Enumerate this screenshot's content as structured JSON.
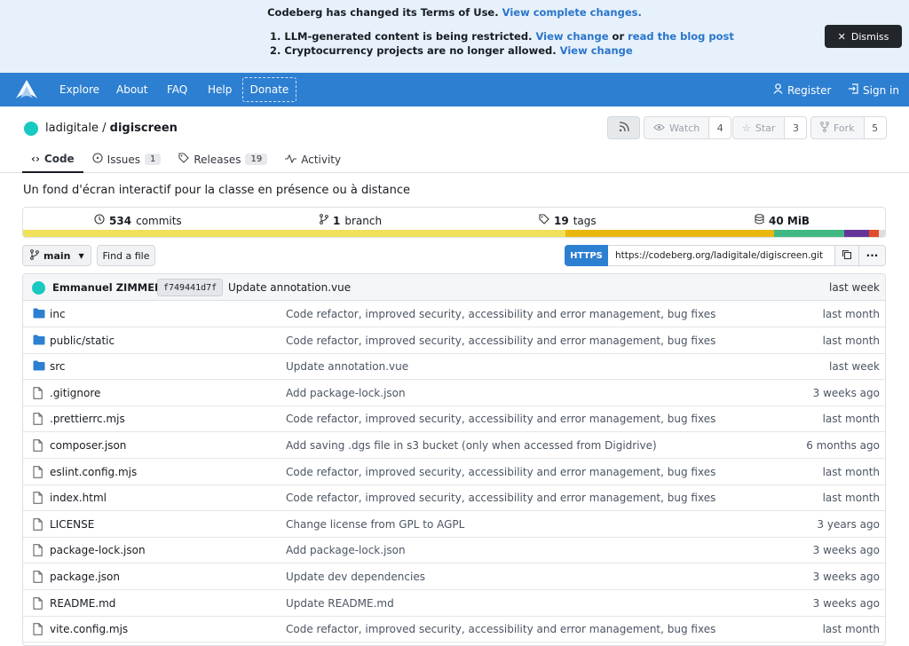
{
  "banner": {
    "headline_pre": "Codeberg has changed its Terms of Use.",
    "headline_link": "View complete changes.",
    "item1_text": "1. LLM-generated content is being restricted.",
    "item1_link1": "View change",
    "item1_or": "or",
    "item1_link2": "read the blog post",
    "item2_text": "2. Cryptocurrency projects are no longer allowed.",
    "item2_link": "View change",
    "dismiss_label": "Dismiss"
  },
  "nav": {
    "explore": "Explore",
    "about": "About",
    "faq": "FAQ",
    "help": "Help",
    "donate": "Donate",
    "register": "Register",
    "signin": "Sign in"
  },
  "repo": {
    "owner": "ladigitale",
    "separator": "/",
    "name": "digiscreen",
    "watch_label": "Watch",
    "watch_count": "4",
    "star_label": "Star",
    "star_count": "3",
    "fork_label": "Fork",
    "fork_count": "5",
    "description": "Un fond d'écran interactif pour la classe en présence ou à distance"
  },
  "tabs": [
    {
      "label": "Code",
      "active": true
    },
    {
      "label": "Issues",
      "count": "1"
    },
    {
      "label": "Releases",
      "count": "19"
    },
    {
      "label": "Activity"
    }
  ],
  "stats": {
    "commits_count": "534",
    "commits_label": "commits",
    "branch_count": "1",
    "branch_label": "branch",
    "tags_count": "19",
    "tags_label": "tags",
    "size": "40 MiB"
  },
  "language_bar": [
    {
      "color": "#f1e05a",
      "share": 0.628
    },
    {
      "color": "#e8b80f",
      "share": 0.241
    },
    {
      "color": "#41b883",
      "share": 0.082
    },
    {
      "color": "#663399",
      "share": 0.028
    },
    {
      "color": "#e34c26",
      "share": 0.012
    },
    {
      "color": "#dddddd",
      "share": 0.009
    }
  ],
  "controls": {
    "branch": "main",
    "find_file": "Find a file",
    "protocol": "HTTPS",
    "clone_url": "https://codeberg.org/ladigitale/digiscreen.git"
  },
  "last_commit": {
    "author": "Emmanuel ZIMMERT",
    "sha": "f749441d7f",
    "message": "Update annotation.vue",
    "age": "last week"
  },
  "files": [
    {
      "name": "inc",
      "type": "folder",
      "message": "Code refactor, improved security, accessibility and error management, bug fixes",
      "age": "last month"
    },
    {
      "name_prefix": "public",
      "name": "/static",
      "type": "folder",
      "message": "Code refactor, improved security, accessibility and error management, bug fixes",
      "age": "last month"
    },
    {
      "name": "src",
      "type": "folder",
      "message": "Update annotation.vue",
      "age": "last week"
    },
    {
      "name": ".gitignore",
      "type": "file",
      "message": "Add package-lock.json",
      "age": "3 weeks ago"
    },
    {
      "name": ".prettierrc.mjs",
      "type": "file",
      "message": "Code refactor, improved security, accessibility and error management, bug fixes",
      "age": "last month"
    },
    {
      "name": "composer.json",
      "type": "file",
      "message": "Add saving .dgs file in s3 bucket (only when accessed from Digidrive)",
      "age": "6 months ago"
    },
    {
      "name": "eslint.config.mjs",
      "type": "file",
      "message": "Code refactor, improved security, accessibility and error management, bug fixes",
      "age": "last month"
    },
    {
      "name": "index.html",
      "type": "file",
      "message": "Code refactor, improved security, accessibility and error management, bug fixes",
      "age": "last month"
    },
    {
      "name": "LICENSE",
      "type": "file",
      "message": "Change license from GPL to AGPL",
      "age": "3 years ago"
    },
    {
      "name": "package-lock.json",
      "type": "file",
      "message": "Add package-lock.json",
      "age": "3 weeks ago"
    },
    {
      "name": "package.json",
      "type": "file",
      "message": "Update dev dependencies",
      "age": "3 weeks ago"
    },
    {
      "name": "README.md",
      "type": "file",
      "message": "Update README.md",
      "age": "3 weeks ago"
    },
    {
      "name": "vite.config.mjs",
      "type": "file",
      "message": "Code refactor, improved security, accessibility and error management, bug fixes",
      "age": "last month"
    }
  ]
}
